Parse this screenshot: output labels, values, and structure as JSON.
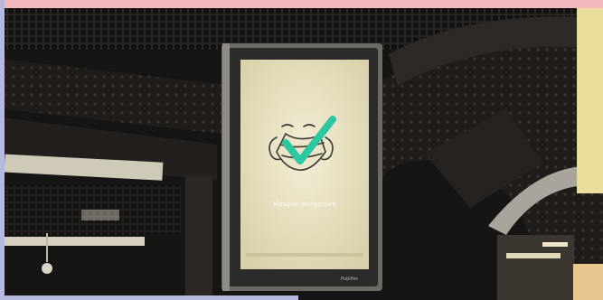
{
  "scene": {
    "screen_text": "Masque obligatoire",
    "brand": "Publifer",
    "icons": [
      "face-mask-icon",
      "check-mark-icon"
    ],
    "colors": {
      "check_mark": "#2cc6a2",
      "screen_background": "#ece6c8",
      "top_frame": "#f2b8bb",
      "left_frame": "#b7b8df",
      "right_frame": "#e9dd9b"
    }
  }
}
